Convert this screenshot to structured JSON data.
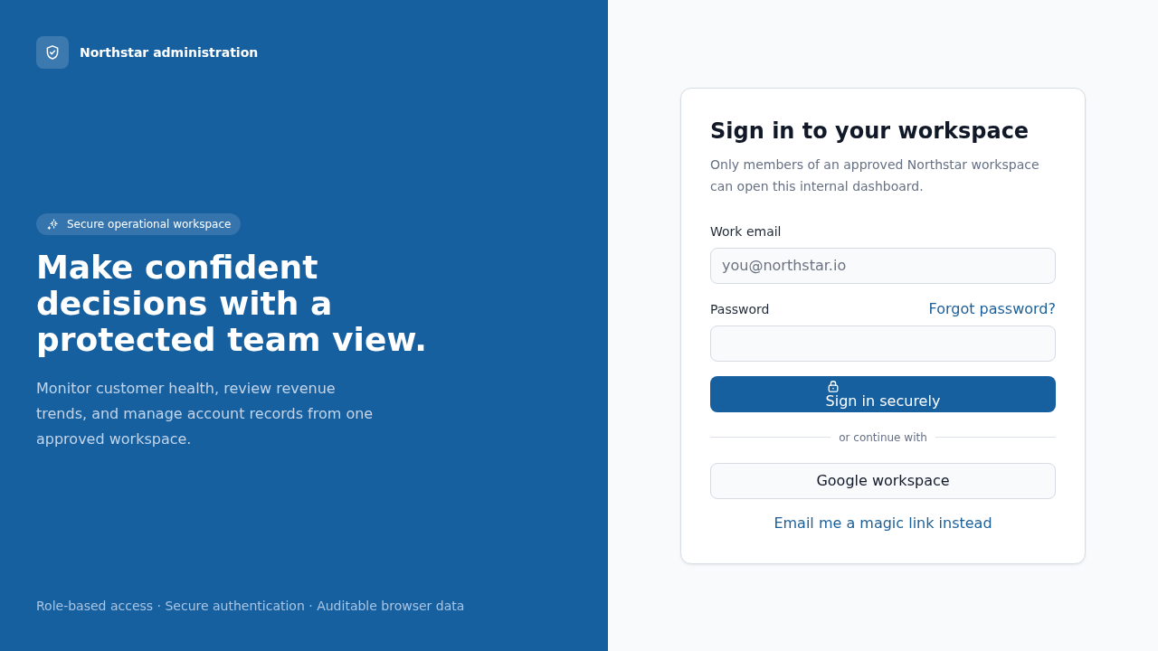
{
  "brand": {
    "name": "Northstar administration"
  },
  "hero": {
    "badge": "Secure operational workspace",
    "heading": "Make confident decisions with a protected team view.",
    "description": "Monitor customer health, review revenue trends, and manage account records from one approved workspace."
  },
  "footer": "Role-based access · Secure authentication · Auditable browser data",
  "sign_in": {
    "title": "Sign in to your workspace",
    "subtitle": "Only members of an approved Northstar workspace can open this internal dashboard.",
    "fields": [
      {
        "label": "Work email",
        "placeholder": "you@northstar.io"
      },
      {
        "label": "Password",
        "link": "Forgot password?"
      }
    ],
    "submit_button": "Sign in securely",
    "divider": "or continue with",
    "alternative_button": "Google workspace",
    "magic_link": "Email me a magic link instead"
  }
}
